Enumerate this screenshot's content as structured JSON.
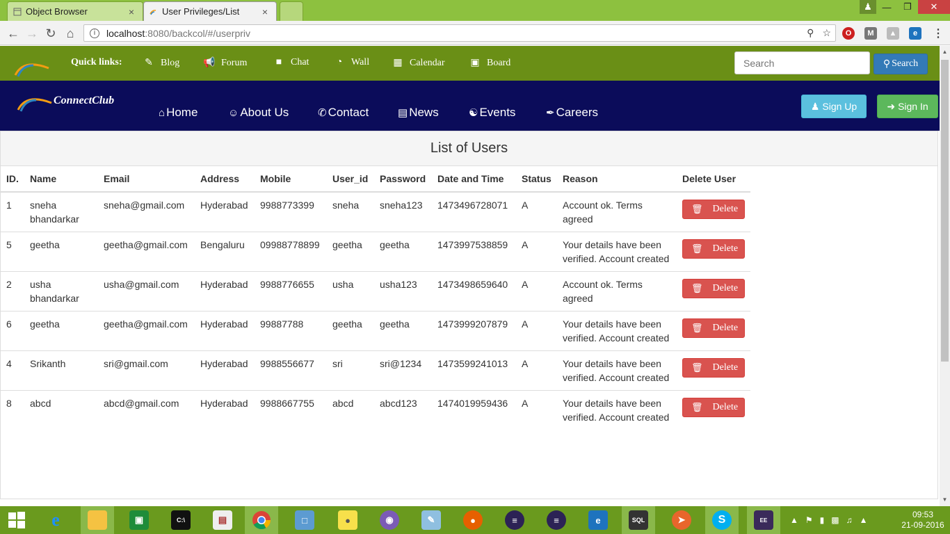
{
  "browser": {
    "tabs": [
      {
        "label": "Object Browser",
        "close": "×"
      },
      {
        "label": "User Privileges/List",
        "close": "×"
      }
    ],
    "url_host": "localhost",
    "url_path": ":8080/backcol/#/userpriv"
  },
  "quickbar": {
    "title": "Quick links:",
    "links": [
      "Blog",
      "Forum",
      "Chat",
      "Wall",
      "Calendar",
      "Board"
    ],
    "search_placeholder": "Search",
    "search_button": "Search"
  },
  "navbar": {
    "brand": "ConnectClub",
    "links": [
      "Home",
      "About Us",
      "Contact",
      "News",
      "Events",
      "Careers"
    ],
    "signup": "Sign Up",
    "signin": "Sign In"
  },
  "panel": {
    "title": "List of Users",
    "columns": [
      "ID.",
      "Name",
      "Email",
      "Address",
      "Mobile",
      "User_id",
      "Password",
      "Date and Time",
      "Status",
      "Reason",
      "Delete User"
    ],
    "delete_label": "Delete",
    "rows": [
      {
        "id": "1",
        "name": "sneha bhandarkar",
        "email": "sneha@gmail.com",
        "address": "Hyderabad",
        "mobile": "9988773399",
        "user_id": "sneha",
        "password": "sneha123",
        "datetime": "1473496728071",
        "status": "A",
        "reason": "Account ok. Terms agreed"
      },
      {
        "id": "5",
        "name": "geetha",
        "email": "geetha@gmail.com",
        "address": "Bengaluru",
        "mobile": "09988778899",
        "user_id": "geetha",
        "password": "geetha",
        "datetime": "1473997538859",
        "status": "A",
        "reason": "Your details have been verified. Account created"
      },
      {
        "id": "2",
        "name": "usha bhandarkar",
        "email": "usha@gmail.com",
        "address": "Hyderabad",
        "mobile": "9988776655",
        "user_id": "usha",
        "password": "usha123",
        "datetime": "1473498659640",
        "status": "A",
        "reason": "Account ok. Terms agreed"
      },
      {
        "id": "6",
        "name": "geetha",
        "email": "geetha@gmail.com",
        "address": "Hyderabad",
        "mobile": "99887788",
        "user_id": "geetha",
        "password": "geetha",
        "datetime": "1473999207879",
        "status": "A",
        "reason": "Your details have been verified. Account created"
      },
      {
        "id": "4",
        "name": "Srikanth",
        "email": "sri@gmail.com",
        "address": "Hyderabad",
        "mobile": "9988556677",
        "user_id": "sri",
        "password": "sri@1234",
        "datetime": "1473599241013",
        "status": "A",
        "reason": "Your details have been verified. Account created"
      },
      {
        "id": "8",
        "name": "abcd",
        "email": "abcd@gmail.com",
        "address": "Hyderabad",
        "mobile": "9988667755",
        "user_id": "abcd",
        "password": "abcd123",
        "datetime": "1474019959436",
        "status": "A",
        "reason": "Your details have been verified. Account created"
      }
    ]
  },
  "taskbar": {
    "time": "09:53",
    "date": "21-09-2016"
  },
  "colors": {
    "quickbar": "#6a8f16",
    "navbar": "#0b0c5a",
    "signup": "#5bc0de",
    "signin": "#5cb85c",
    "delete": "#d9534f",
    "search_button": "#337ab7"
  }
}
